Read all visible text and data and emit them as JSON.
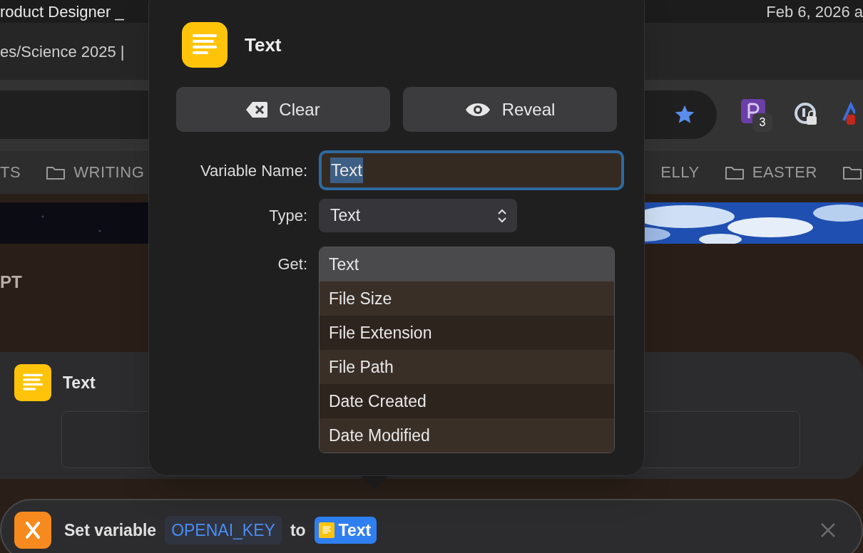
{
  "menu_bar": {
    "title": "roduct Designer _",
    "clock": "Feb 6, 2026 a"
  },
  "browser_tab": {
    "title": "es/Science 2025 |"
  },
  "extensions": [
    {
      "kind": "letter",
      "badge": "3"
    },
    {
      "kind": "lock"
    },
    {
      "kind": "partial"
    }
  ],
  "bookmarks_left": [
    {
      "kind": "text",
      "label": "TS"
    },
    {
      "kind": "folder",
      "label": "WRITING"
    }
  ],
  "bookmarks_right": [
    {
      "kind": "text",
      "label": "ELLY"
    },
    {
      "kind": "folder",
      "label": "EASTER"
    },
    {
      "kind": "folder_only"
    }
  ],
  "page": {
    "heading": "PT"
  },
  "text_action": {
    "title": "Text"
  },
  "set_variable_action": {
    "verb": "Set variable",
    "variable": "OPENAI_KEY",
    "connector": "to",
    "value": "Text"
  },
  "popover": {
    "title": "Text",
    "buttons": [
      {
        "kind": "clear",
        "label": "Clear"
      },
      {
        "kind": "reveal",
        "label": "Reveal"
      }
    ],
    "variable_name": {
      "label": "Variable Name:",
      "value": "Text",
      "text_selected": true
    },
    "type": {
      "label": "Type:",
      "value": "Text"
    },
    "get": {
      "label": "Get:",
      "options": [
        {
          "label": "Text",
          "selected": true
        },
        {
          "label": "File Size",
          "selected": false
        },
        {
          "label": "File Extension",
          "selected": false
        },
        {
          "label": "File Path",
          "selected": false
        },
        {
          "label": "Date Created",
          "selected": false
        },
        {
          "label": "Date Modified",
          "selected": false
        }
      ]
    }
  }
}
